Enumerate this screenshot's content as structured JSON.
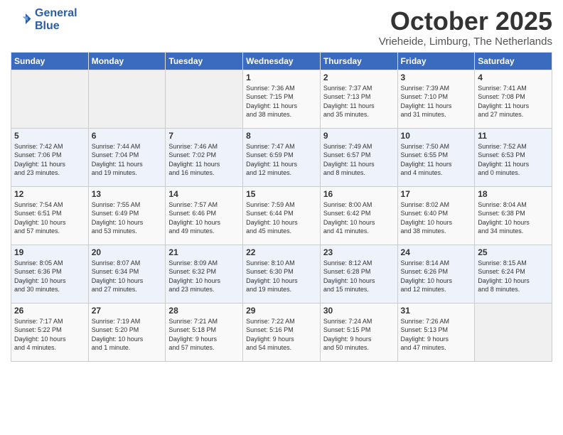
{
  "header": {
    "logo_line1": "General",
    "logo_line2": "Blue",
    "month": "October 2025",
    "location": "Vrieheide, Limburg, The Netherlands"
  },
  "weekdays": [
    "Sunday",
    "Monday",
    "Tuesday",
    "Wednesday",
    "Thursday",
    "Friday",
    "Saturday"
  ],
  "weeks": [
    [
      {
        "day": "",
        "info": ""
      },
      {
        "day": "",
        "info": ""
      },
      {
        "day": "",
        "info": ""
      },
      {
        "day": "1",
        "info": "Sunrise: 7:36 AM\nSunset: 7:15 PM\nDaylight: 11 hours\nand 38 minutes."
      },
      {
        "day": "2",
        "info": "Sunrise: 7:37 AM\nSunset: 7:13 PM\nDaylight: 11 hours\nand 35 minutes."
      },
      {
        "day": "3",
        "info": "Sunrise: 7:39 AM\nSunset: 7:10 PM\nDaylight: 11 hours\nand 31 minutes."
      },
      {
        "day": "4",
        "info": "Sunrise: 7:41 AM\nSunset: 7:08 PM\nDaylight: 11 hours\nand 27 minutes."
      }
    ],
    [
      {
        "day": "5",
        "info": "Sunrise: 7:42 AM\nSunset: 7:06 PM\nDaylight: 11 hours\nand 23 minutes."
      },
      {
        "day": "6",
        "info": "Sunrise: 7:44 AM\nSunset: 7:04 PM\nDaylight: 11 hours\nand 19 minutes."
      },
      {
        "day": "7",
        "info": "Sunrise: 7:46 AM\nSunset: 7:02 PM\nDaylight: 11 hours\nand 16 minutes."
      },
      {
        "day": "8",
        "info": "Sunrise: 7:47 AM\nSunset: 6:59 PM\nDaylight: 11 hours\nand 12 minutes."
      },
      {
        "day": "9",
        "info": "Sunrise: 7:49 AM\nSunset: 6:57 PM\nDaylight: 11 hours\nand 8 minutes."
      },
      {
        "day": "10",
        "info": "Sunrise: 7:50 AM\nSunset: 6:55 PM\nDaylight: 11 hours\nand 4 minutes."
      },
      {
        "day": "11",
        "info": "Sunrise: 7:52 AM\nSunset: 6:53 PM\nDaylight: 11 hours\nand 0 minutes."
      }
    ],
    [
      {
        "day": "12",
        "info": "Sunrise: 7:54 AM\nSunset: 6:51 PM\nDaylight: 10 hours\nand 57 minutes."
      },
      {
        "day": "13",
        "info": "Sunrise: 7:55 AM\nSunset: 6:49 PM\nDaylight: 10 hours\nand 53 minutes."
      },
      {
        "day": "14",
        "info": "Sunrise: 7:57 AM\nSunset: 6:46 PM\nDaylight: 10 hours\nand 49 minutes."
      },
      {
        "day": "15",
        "info": "Sunrise: 7:59 AM\nSunset: 6:44 PM\nDaylight: 10 hours\nand 45 minutes."
      },
      {
        "day": "16",
        "info": "Sunrise: 8:00 AM\nSunset: 6:42 PM\nDaylight: 10 hours\nand 41 minutes."
      },
      {
        "day": "17",
        "info": "Sunrise: 8:02 AM\nSunset: 6:40 PM\nDaylight: 10 hours\nand 38 minutes."
      },
      {
        "day": "18",
        "info": "Sunrise: 8:04 AM\nSunset: 6:38 PM\nDaylight: 10 hours\nand 34 minutes."
      }
    ],
    [
      {
        "day": "19",
        "info": "Sunrise: 8:05 AM\nSunset: 6:36 PM\nDaylight: 10 hours\nand 30 minutes."
      },
      {
        "day": "20",
        "info": "Sunrise: 8:07 AM\nSunset: 6:34 PM\nDaylight: 10 hours\nand 27 minutes."
      },
      {
        "day": "21",
        "info": "Sunrise: 8:09 AM\nSunset: 6:32 PM\nDaylight: 10 hours\nand 23 minutes."
      },
      {
        "day": "22",
        "info": "Sunrise: 8:10 AM\nSunset: 6:30 PM\nDaylight: 10 hours\nand 19 minutes."
      },
      {
        "day": "23",
        "info": "Sunrise: 8:12 AM\nSunset: 6:28 PM\nDaylight: 10 hours\nand 15 minutes."
      },
      {
        "day": "24",
        "info": "Sunrise: 8:14 AM\nSunset: 6:26 PM\nDaylight: 10 hours\nand 12 minutes."
      },
      {
        "day": "25",
        "info": "Sunrise: 8:15 AM\nSunset: 6:24 PM\nDaylight: 10 hours\nand 8 minutes."
      }
    ],
    [
      {
        "day": "26",
        "info": "Sunrise: 7:17 AM\nSunset: 5:22 PM\nDaylight: 10 hours\nand 4 minutes."
      },
      {
        "day": "27",
        "info": "Sunrise: 7:19 AM\nSunset: 5:20 PM\nDaylight: 10 hours\nand 1 minute."
      },
      {
        "day": "28",
        "info": "Sunrise: 7:21 AM\nSunset: 5:18 PM\nDaylight: 9 hours\nand 57 minutes."
      },
      {
        "day": "29",
        "info": "Sunrise: 7:22 AM\nSunset: 5:16 PM\nDaylight: 9 hours\nand 54 minutes."
      },
      {
        "day": "30",
        "info": "Sunrise: 7:24 AM\nSunset: 5:15 PM\nDaylight: 9 hours\nand 50 minutes."
      },
      {
        "day": "31",
        "info": "Sunrise: 7:26 AM\nSunset: 5:13 PM\nDaylight: 9 hours\nand 47 minutes."
      },
      {
        "day": "",
        "info": ""
      }
    ]
  ]
}
